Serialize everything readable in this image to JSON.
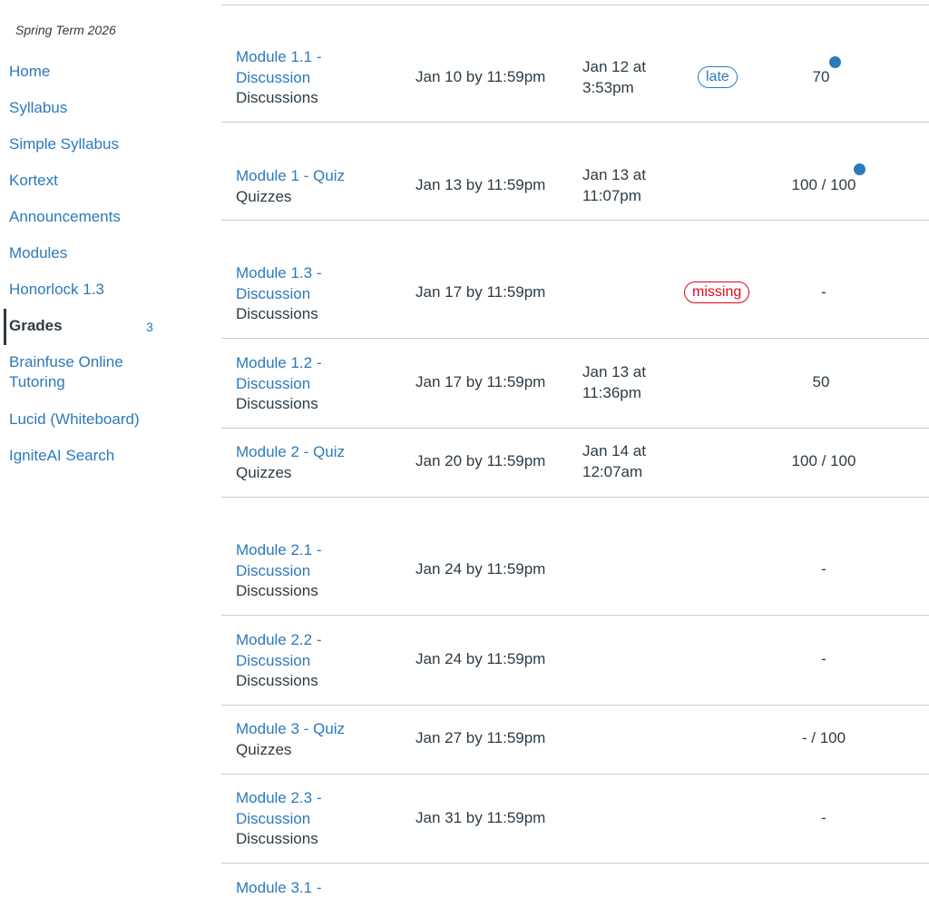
{
  "sidebar": {
    "term": "Spring Term 2026",
    "items": [
      {
        "label": "Home"
      },
      {
        "label": "Syllabus"
      },
      {
        "label": "Simple Syllabus"
      },
      {
        "label": "Kortext"
      },
      {
        "label": "Announcements"
      },
      {
        "label": "Modules"
      },
      {
        "label": "Honorlock 1.3"
      },
      {
        "label": "Grades",
        "badge": "3"
      },
      {
        "label": "Brainfuse Online\nTutoring"
      },
      {
        "label": "Lucid (Whiteboard)"
      },
      {
        "label": "IgniteAI Search"
      }
    ]
  },
  "colors": {
    "link": "#2b7abc",
    "text": "#2d3b45",
    "missing": "#e0061f",
    "separator": "#c7cdd1"
  },
  "assignments": [
    {
      "title_line1": "Module 1.1 -",
      "title_line2": "Discussion",
      "type": "Discussions",
      "due": "Jan 10 by 11:59pm",
      "submitted_line1": "Jan 12 at",
      "submitted_line2": "3:53pm",
      "status": "late",
      "score": "70",
      "unread": true
    },
    {
      "title_line1": "Module 1 - Quiz",
      "title_line2": "",
      "type": "Quizzes",
      "due": "Jan 13 by 11:59pm",
      "submitted_line1": "Jan 13 at",
      "submitted_line2": "11:07pm",
      "status": "",
      "score": "100 / 100",
      "unread": true
    },
    {
      "title_line1": "Module 1.3 -",
      "title_line2": "Discussion",
      "type": "Discussions",
      "due": "Jan 17 by 11:59pm",
      "submitted_line1": "",
      "submitted_line2": "",
      "status": "missing",
      "score": "-",
      "unread": false
    },
    {
      "title_line1": "Module 1.2 -",
      "title_line2": "Discussion",
      "type": "Discussions",
      "due": "Jan 17 by 11:59pm",
      "submitted_line1": "Jan 13 at",
      "submitted_line2": "11:36pm",
      "status": "",
      "score": "50",
      "unread": false
    },
    {
      "title_line1": "Module 2 - Quiz",
      "title_line2": "",
      "type": "Quizzes",
      "due": "Jan 20 by 11:59pm",
      "submitted_line1": "Jan 14 at",
      "submitted_line2": "12:07am",
      "status": "",
      "score": "100 / 100",
      "unread": false
    },
    {
      "title_line1": "Module 2.1 -",
      "title_line2": "Discussion",
      "type": "Discussions",
      "due": "Jan 24 by 11:59pm",
      "submitted_line1": "",
      "submitted_line2": "",
      "status": "",
      "score": "-",
      "unread": false
    },
    {
      "title_line1": "Module 2.2 -",
      "title_line2": "Discussion",
      "type": "Discussions",
      "due": "Jan 24 by 11:59pm",
      "submitted_line1": "",
      "submitted_line2": "",
      "status": "",
      "score": "-",
      "unread": false
    },
    {
      "title_line1": "Module 3 - Quiz",
      "title_line2": "",
      "type": "Quizzes",
      "due": "Jan 27 by 11:59pm",
      "submitted_line1": "",
      "submitted_line2": "",
      "status": "",
      "score": "- / 100",
      "unread": false
    },
    {
      "title_line1": "Module 2.3 -",
      "title_line2": "Discussion",
      "type": "Discussions",
      "due": "Jan 31 by 11:59pm",
      "submitted_line1": "",
      "submitted_line2": "",
      "status": "",
      "score": "-",
      "unread": false
    },
    {
      "title_line1": "Module 3.1 -",
      "title_line2": "",
      "type": "",
      "due": "",
      "submitted_line1": "",
      "submitted_line2": "",
      "status": "",
      "score": "",
      "unread": false
    }
  ]
}
